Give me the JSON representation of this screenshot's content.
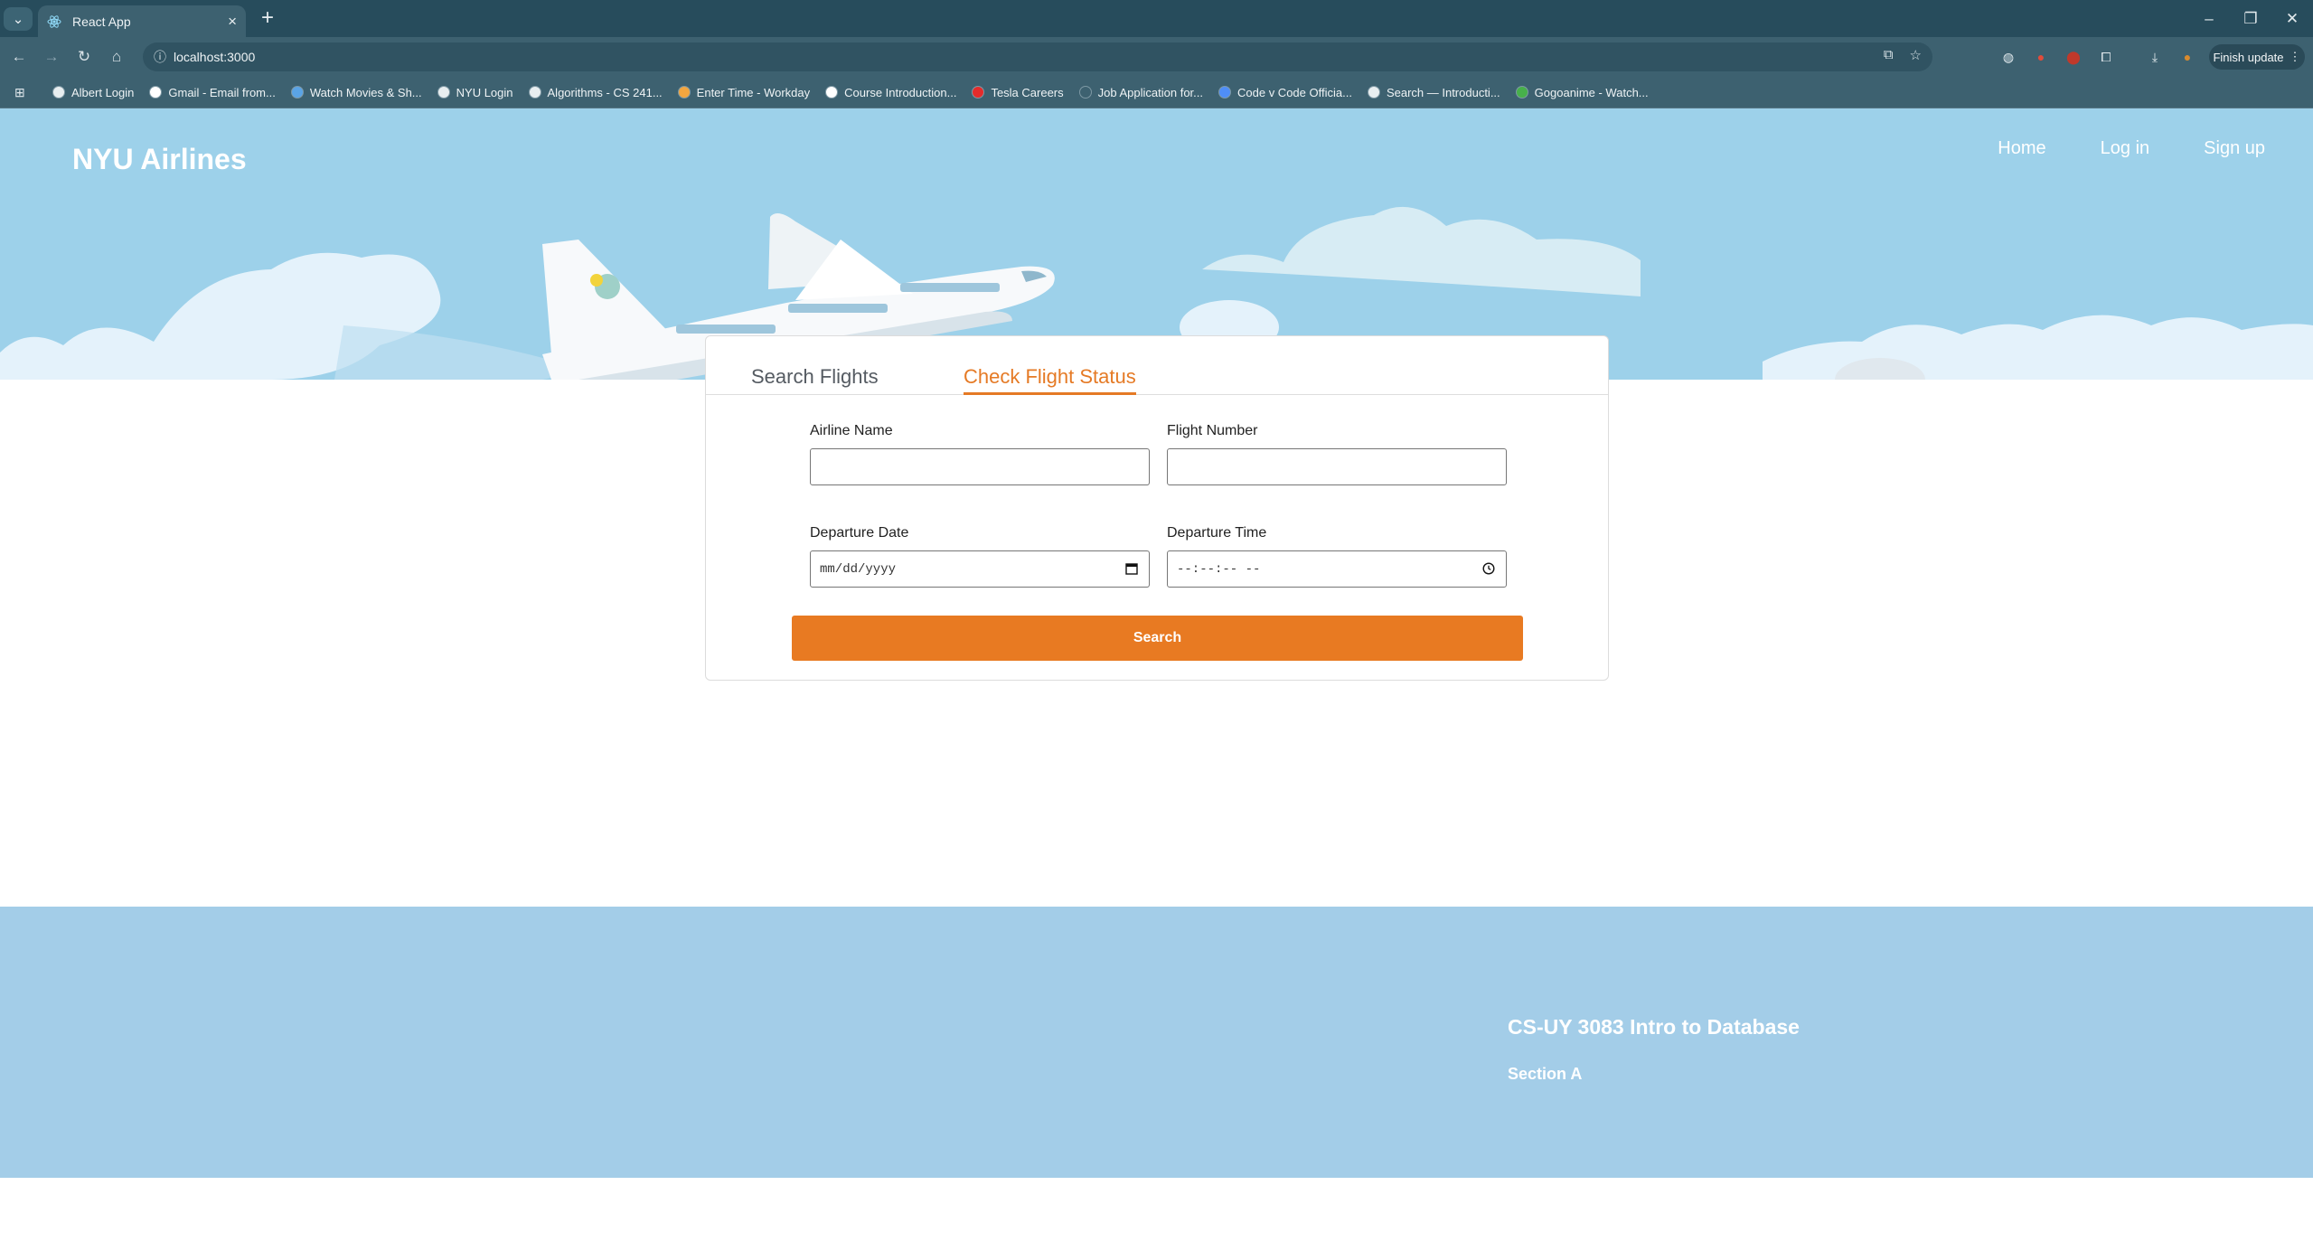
{
  "browser": {
    "tab_title": "React App",
    "url": "localhost:3000",
    "finish_update": "Finish update",
    "bookmarks": [
      {
        "label": "Albert Login",
        "icon": "globe-icon",
        "color": "#e8eef0"
      },
      {
        "label": "Gmail - Email from...",
        "icon": "google-icon",
        "color": "#ffffff"
      },
      {
        "label": "Watch Movies & Sh...",
        "icon": "circle-icon",
        "color": "#5aa4e6"
      },
      {
        "label": "NYU Login",
        "icon": "globe-icon",
        "color": "#e8eef0"
      },
      {
        "label": "Algorithms - CS 241...",
        "icon": "globe-icon",
        "color": "#e8eef0"
      },
      {
        "label": "Enter Time - Workday",
        "icon": "workday-icon",
        "color": "#f2a640"
      },
      {
        "label": "Course Introduction...",
        "icon": "cs-icon",
        "color": "#ffffff"
      },
      {
        "label": "Tesla Careers",
        "icon": "tesla-icon",
        "color": "#e52b2b"
      },
      {
        "label": "Job Application for...",
        "icon": "blank-icon",
        "color": "#3d6170"
      },
      {
        "label": "Code v Code Officia...",
        "icon": "docs-icon",
        "color": "#4f8ef7"
      },
      {
        "label": "Search — Introducti...",
        "icon": "globe-icon",
        "color": "#e8eef0"
      },
      {
        "label": "Gogoanime - Watch...",
        "icon": "leaf-icon",
        "color": "#47b04b"
      }
    ]
  },
  "header": {
    "brand": "NYU Airlines",
    "nav": [
      "Home",
      "Log in",
      "Sign up"
    ]
  },
  "card": {
    "tabs": [
      "Search Flights",
      "Check Flight Status"
    ],
    "active_tab": "Check Flight Status",
    "fields": {
      "airline_name": {
        "label": "Airline Name",
        "value": ""
      },
      "flight_number": {
        "label": "Flight Number",
        "value": ""
      },
      "departure_date": {
        "label": "Departure Date",
        "placeholder": "mm/dd/yyyy"
      },
      "departure_time": {
        "label": "Departure Time",
        "placeholder": "--:--:-- --"
      }
    },
    "search_label": "Search"
  },
  "footer": {
    "course": "CS-UY 3083 Intro to Database",
    "section": "Section A"
  },
  "colors": {
    "accent": "#e87a22",
    "sky": "#9dd1ea",
    "footer": "#a3cde8"
  }
}
